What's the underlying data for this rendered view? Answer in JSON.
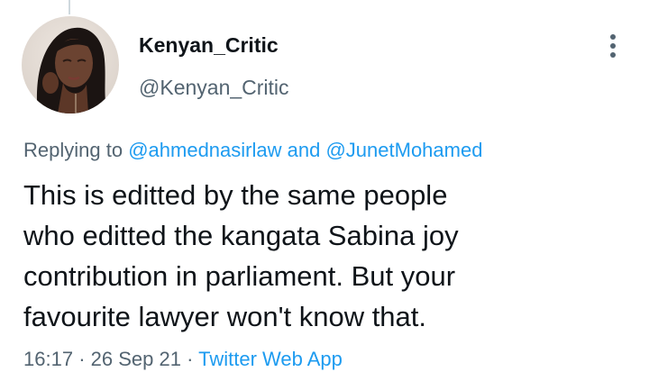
{
  "tweet": {
    "author": {
      "display_name": "Kenyan_Critic",
      "handle": "@Kenyan_Critic",
      "avatar_icon": "profile-photo"
    },
    "more_icon": "more-vertical-icon",
    "replying_to": {
      "prefix": "Replying to",
      "mentions": [
        "@ahmednasirlaw",
        "@JunetMohamed"
      ],
      "conjunction": "and"
    },
    "text_lines": [
      "This is editted by the same people",
      "who editted the kangata Sabina joy",
      "contribution in parliament. But your",
      "favourite lawyer won't know that."
    ],
    "meta": {
      "time": "16:17",
      "separator": "·",
      "date": "26 Sep 21",
      "source": "Twitter Web App"
    }
  },
  "colors": {
    "text_primary": "#0f1419",
    "text_secondary": "#536471",
    "link": "#1d9bf0",
    "thread_line": "#cfd9de"
  }
}
